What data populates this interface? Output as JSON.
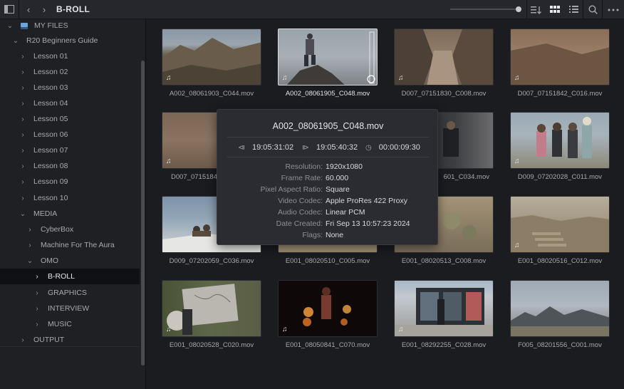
{
  "topbar": {
    "title": "B-ROLL",
    "icons": [
      "sidebar-toggle-icon",
      "back-icon",
      "forward-icon",
      "sort-icon",
      "grid-view-icon",
      "list-view-icon",
      "search-icon",
      "more-icon"
    ]
  },
  "sidebar": {
    "items": [
      {
        "label": "MY FILES",
        "chev": "⌄"
      },
      {
        "label": "R20 Beginners Guide",
        "chev": "⌄"
      },
      {
        "label": "Lesson 01",
        "chev": "›"
      },
      {
        "label": "Lesson 02",
        "chev": "›"
      },
      {
        "label": "Lesson 03",
        "chev": "›"
      },
      {
        "label": "Lesson 04",
        "chev": "›"
      },
      {
        "label": "Lesson 05",
        "chev": "›"
      },
      {
        "label": "Lesson 06",
        "chev": "›"
      },
      {
        "label": "Lesson 07",
        "chev": "›"
      },
      {
        "label": "Lesson 08",
        "chev": "›"
      },
      {
        "label": "Lesson 09",
        "chev": "›"
      },
      {
        "label": "Lesson 10",
        "chev": "›"
      },
      {
        "label": "MEDIA",
        "chev": "⌄"
      },
      {
        "label": "CyberBox",
        "chev": "›"
      },
      {
        "label": "Machine For The Aura",
        "chev": "›"
      },
      {
        "label": "OMO",
        "chev": "⌄"
      },
      {
        "label": "B-ROLL",
        "chev": "›"
      },
      {
        "label": "GRAPHICS",
        "chev": "›"
      },
      {
        "label": "INTERVIEW",
        "chev": "›"
      },
      {
        "label": "MUSIC",
        "chev": "›"
      },
      {
        "label": "OUTPUT",
        "chev": "›"
      }
    ]
  },
  "clips": [
    {
      "name": "A002_08061903_C044.mov"
    },
    {
      "name": "A002_08061905_C048.mov"
    },
    {
      "name": "D007_07151830_C008.mov"
    },
    {
      "name": "D007_07151842_C016.mov"
    },
    {
      "name": "D007_0715184"
    },
    {
      "name": ""
    },
    {
      "name": "601_C034.mov"
    },
    {
      "name": "D009_07202028_C011.mov"
    },
    {
      "name": "D009_07202059_C036.mov"
    },
    {
      "name": "E001_08020510_C005.mov"
    },
    {
      "name": "E001_08020513_C008.mov"
    },
    {
      "name": "E001_08020516_C012.mov"
    },
    {
      "name": "E001_08020528_C020.mov"
    },
    {
      "name": "E001_08050841_C070.mov"
    },
    {
      "name": "E001_08292255_C028.mov"
    },
    {
      "name": "F005_08201556_C001.mov"
    }
  ],
  "tooltip": {
    "title": "A002_08061905_C048.mov",
    "tc_in": "19:05:31:02",
    "tc_out": "19:05:40:32",
    "duration": "00:00:09:30",
    "meta": [
      {
        "k": "Resolution:",
        "v": "1920x1080"
      },
      {
        "k": "Frame Rate:",
        "v": "60.000"
      },
      {
        "k": "Pixel Aspect Ratio:",
        "v": "Square"
      },
      {
        "k": "Video Codec:",
        "v": "Apple ProRes 422 Proxy"
      },
      {
        "k": "Audio Codec:",
        "v": "Linear PCM"
      },
      {
        "k": "Date Created:",
        "v": "Fri Sep 13 10:57:23 2024"
      },
      {
        "k": "Flags:",
        "v": "None"
      }
    ]
  },
  "colors": {
    "accent_folder": "#6ea6d9",
    "selected_bg": "#101114"
  }
}
